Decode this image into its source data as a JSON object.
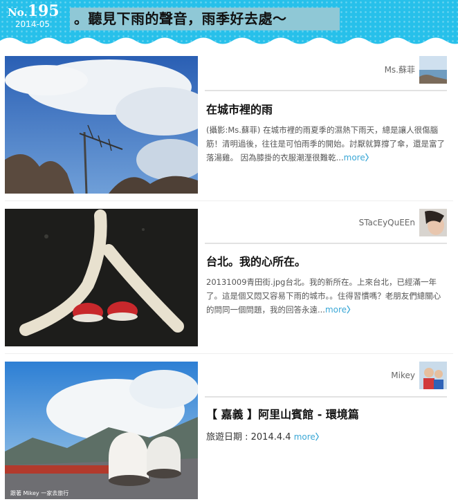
{
  "header": {
    "issue_prefix": "No.",
    "issue_number": "195",
    "issue_date": "2014-05",
    "title": "。聽見下雨的聲音，雨季好去處～"
  },
  "articles": [
    {
      "author": "Ms.蘇菲",
      "title": "在城市裡的雨",
      "body": "(攝影:Ms.蘇菲) 在城市裡的雨夏季的濕熱下雨天，總是讓人很傷腦筋！清明過後，往往是可怕雨季的開始。討厭就算撐了傘，還是富了落湯雞。 因為膝掛的衣服潮溼很難乾...",
      "more": "more",
      "image_icon": "antenna-sky-photo"
    },
    {
      "author": "STacEyQuEEn",
      "title": "台北。我的心所在。",
      "body": "20131009青田街.jpg台北。我的新所在。上來台北，已經滿一年了。這是個又悶又容易下雨的城市。。住得習慣嗎？老朋友們總關心的問同一個問題，我的回答永遠...",
      "more": "more",
      "image_icon": "ren-character-road-photo"
    },
    {
      "author": "Mikey",
      "title": "【 嘉義 】阿里山賓館 - 環境篇",
      "meta": "旅遊日期 : 2014.4.4",
      "more": "more",
      "caption": "跟著 Mikey 一家去旅行",
      "image_icon": "mountain-terrace-photo"
    }
  ],
  "colors": {
    "header_bg": "#27c0ea",
    "title_box_bg": "#8fc8d6",
    "link": "#3aa7d6"
  }
}
